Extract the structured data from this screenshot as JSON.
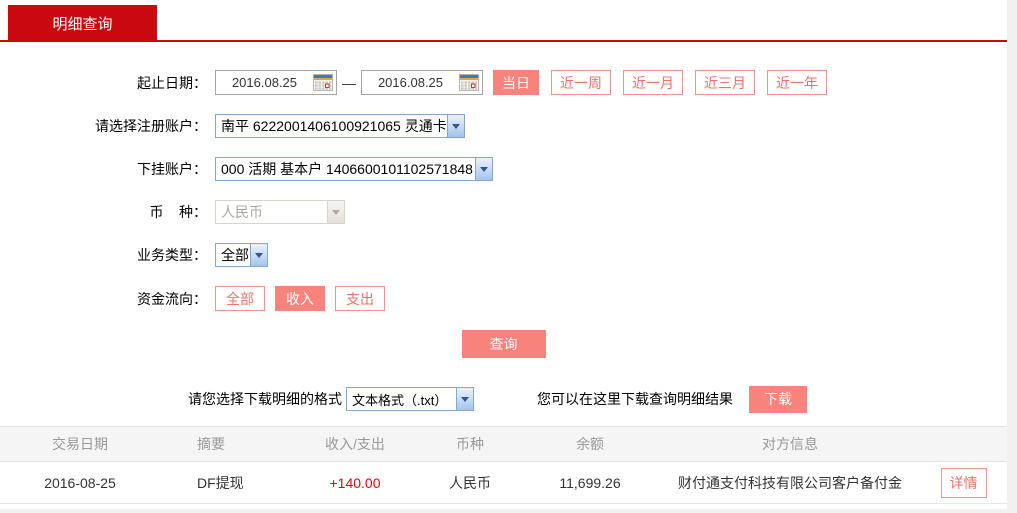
{
  "page": {
    "tab_label": "明细查询"
  },
  "form": {
    "date_range": {
      "label": "起止日期：",
      "start_value": "2016.08.25",
      "end_value": "2016.08.25",
      "separator": "—"
    },
    "quick_ranges": {
      "today": "当日",
      "last_week": "近一周",
      "last_month": "近一月",
      "last_quarter": "近三月",
      "last_year": "近一年"
    },
    "registered_account": {
      "label": "请选择注册账户：",
      "value": "南平 6222001406100921065 灵通卡"
    },
    "sub_account": {
      "label": "下挂账户：",
      "value": "000 活期 基本户 1406600101102571848"
    },
    "currency": {
      "label": "币    种：",
      "value": "人民币",
      "disabled": true
    },
    "business_type": {
      "label": "业务类型：",
      "value": "全部"
    },
    "fund_direction": {
      "label": "资金流向：",
      "all": "全部",
      "income": "收入",
      "expense": "支出",
      "selected": "收入"
    },
    "query_button": "查询"
  },
  "download": {
    "format_label": "请您选择下载明细的格式",
    "format_value": "文本格式（.txt）",
    "hint": "您可以在这里下载查询明细结果",
    "button": "下载"
  },
  "table": {
    "headers": [
      "交易日期",
      "摘要",
      "收入/支出",
      "币种",
      "余额",
      "对方信息"
    ],
    "rows": [
      {
        "date": "2016-08-25",
        "summary": "DF提现",
        "amount": "+140.00",
        "currency": "人民币",
        "balance": "11,699.26",
        "counterparty": "财付通支付科技有限公司客户备付金",
        "detail_label": "详情"
      }
    ]
  },
  "icons": {
    "calendar": "calendar-grid-icon",
    "select_arrow": "chevron-down-icon"
  },
  "colors": {
    "brand_red": "#c9090f",
    "accent_salmon": "#f8827c",
    "accent_salmon_border": "#f5918d",
    "accent_salmon_text": "#f0716c",
    "amount_red": "#e60012",
    "table_header_bg": "#f5f5f5",
    "table_header_text": "#999999",
    "page_bg": "#f1f1f1"
  }
}
